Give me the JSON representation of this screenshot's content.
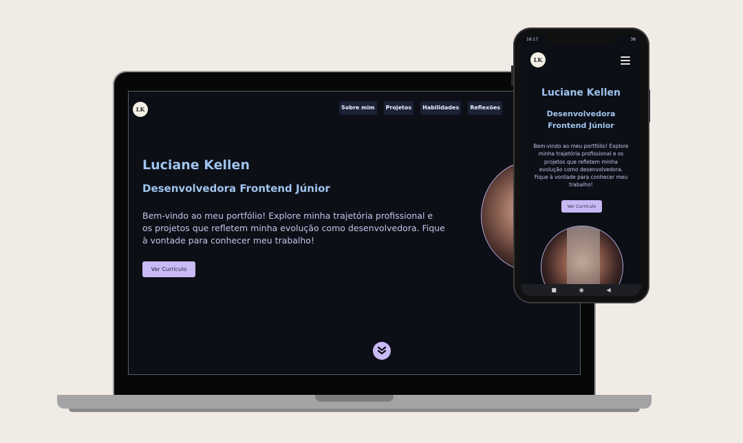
{
  "brand": {
    "logo_text": "LK"
  },
  "nav": {
    "items": [
      {
        "label": "Sobre mim"
      },
      {
        "label": "Projetos"
      },
      {
        "label": "Habilidades"
      },
      {
        "label": "Reflexões"
      }
    ]
  },
  "hero": {
    "name": "Luciane Kellen",
    "role": "Desenvolvedora Frontend Júnior",
    "role_mobile_line1": "Desenvolvedora",
    "role_mobile_line2": "Frontend Júnior",
    "intro": "Bem-vindo ao meu portfólio! Explore minha trajetória profissional e os projetos que refletem minha evolução como desenvolvedora. Fique à vontade para conhecer meu trabalho!",
    "cv_button": "Ver Currículo"
  },
  "phone": {
    "status_time": "16:17",
    "status_battery": "38"
  },
  "colors": {
    "background": "#f1ebe6",
    "screen": "#0d0f16",
    "accent": "#c9b9f4",
    "heading": "#9fc4ee",
    "nav_button": "#1b2236"
  },
  "icons": {
    "scroll_down": "double-chevron-down-icon",
    "menu": "hamburger-icon"
  }
}
